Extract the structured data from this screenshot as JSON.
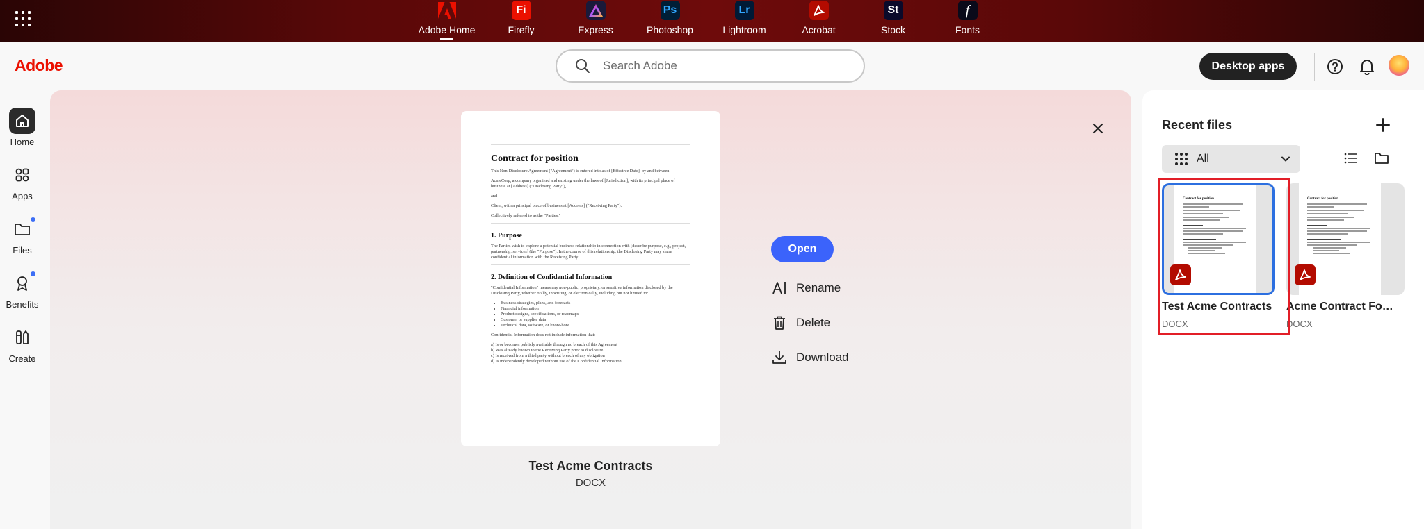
{
  "appbar": {
    "apps": [
      {
        "label": "Adobe Home",
        "icon": "adobe-home-icon",
        "glyph": "",
        "color": "#eb1000",
        "active": true
      },
      {
        "label": "Firefly",
        "icon": "firefly-icon",
        "glyph": "Fi",
        "color": "#eb1000",
        "active": false
      },
      {
        "label": "Express",
        "icon": "express-icon",
        "glyph": "",
        "color": "#1a1a3a",
        "active": false
      },
      {
        "label": "Photoshop",
        "icon": "photoshop-icon",
        "glyph": "Ps",
        "color": "#001e36",
        "active": false
      },
      {
        "label": "Lightroom",
        "icon": "lightroom-icon",
        "glyph": "Lr",
        "color": "#001a36",
        "active": false
      },
      {
        "label": "Acrobat",
        "icon": "acrobat-icon",
        "glyph": "",
        "color": "#b30b00",
        "active": false
      },
      {
        "label": "Stock",
        "icon": "stock-icon",
        "glyph": "St",
        "color": "#0a0a2a",
        "active": false
      },
      {
        "label": "Fonts",
        "icon": "fonts-icon",
        "glyph": "f",
        "color": "#0a0a1a",
        "active": false
      }
    ]
  },
  "header": {
    "logo": "Adobe",
    "search_placeholder": "Search Adobe",
    "desktop_apps": "Desktop apps"
  },
  "leftnav": {
    "items": [
      {
        "label": "Home",
        "active": true,
        "dot": false
      },
      {
        "label": "Apps",
        "active": false,
        "dot": false
      },
      {
        "label": "Files",
        "active": false,
        "dot": true
      },
      {
        "label": "Benefits",
        "active": false,
        "dot": true
      },
      {
        "label": "Create",
        "active": false,
        "dot": false
      }
    ]
  },
  "preview": {
    "doc": {
      "title": "Contract for position",
      "intro": "This Non-Disclosure Agreement (\"Agreement\") is entered into as of [Effective Date], by and between:",
      "party1": "AcmeCorp, a company organized and existing under the laws of [Jurisdiction], with its principal place of business at [Address] (\"Disclosing Party\"),",
      "and": "and",
      "party2": "Client, with a principal place of business at [Address] (\"Receiving Party\").",
      "collective": "Collectively referred to as the \"Parties.\"",
      "h1": "1. Purpose",
      "purpose": "The Parties wish to explore a potential business relationship in connection with [describe purpose, e.g., project, partnership, services] (the \"Purpose\"). In the course of this relationship, the Disclosing Party may share confidential information with the Receiving Party.",
      "h2": "2. Definition of Confidential Information",
      "definition": "\"Confidential Information\" means any non-public, proprietary, or sensitive information disclosed by the Disclosing Party, whether orally, in writing, or electronically, including but not limited to:",
      "bullets": [
        "Business strategies, plans, and forecasts",
        "Financial information",
        "Product designs, specifications, or roadmaps",
        "Customer or supplier data",
        "Technical data, software, or know-how"
      ],
      "exclusion": "Confidential Information does not include information that:",
      "items": [
        "a) Is or becomes publicly available through no breach of this Agreement",
        "b) Was already known to the Receiving Party prior to disclosure",
        "c) Is received from a third party without breach of any obligation",
        "d) Is independently developed without use of the Confidential Information"
      ]
    },
    "file_name": "Test Acme Contracts",
    "file_type": "DOCX",
    "open": "Open",
    "rename": "Rename",
    "delete": "Delete",
    "download": "Download"
  },
  "recent": {
    "title": "Recent files",
    "filter": "All",
    "files": [
      {
        "name": "Test Acme Contracts",
        "type": "DOCX",
        "selected": true
      },
      {
        "name": "Acme Contract For ...",
        "type": "DOCX",
        "selected": false
      }
    ],
    "thumb_title": "Contract for position"
  },
  "colors": {
    "accent": "#3b63fb",
    "adobe_red": "#eb1000",
    "selection": "#2c6fe0",
    "highlight": "#e21e27"
  }
}
